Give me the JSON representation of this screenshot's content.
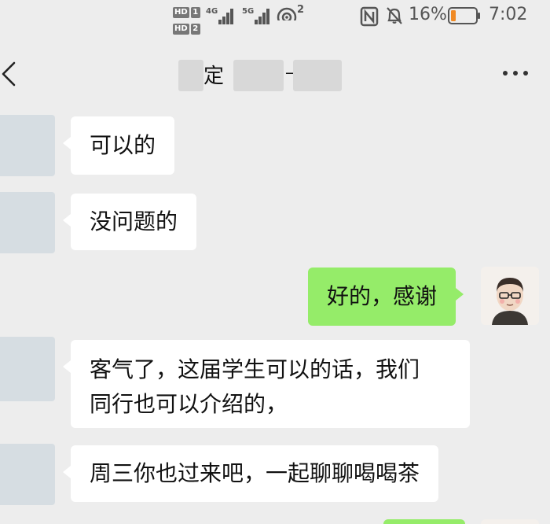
{
  "status_bar": {
    "hd1": "HD",
    "hd1_num": "1",
    "hd2": "HD",
    "hd2_num": "2",
    "net1": "4G",
    "net2": "5G",
    "hotspot_num": "2",
    "battery": "16%",
    "time": "7:02",
    "icons": [
      "nfc-icon",
      "mute-icon",
      "battery-icon",
      "hotspot-icon"
    ]
  },
  "header": {
    "title_visible": "定",
    "title_separator": "—",
    "back_icon": "back-chevron-icon",
    "more_icon": "more-dots-icon"
  },
  "messages": [
    {
      "side": "left",
      "text": "可以的"
    },
    {
      "side": "left",
      "text": "没问题的"
    },
    {
      "side": "right",
      "text": "好的，感谢"
    },
    {
      "side": "left",
      "text_line1": "客气了，这届学生可以的话，我们",
      "text_line2": "同行也可以介绍的，"
    },
    {
      "side": "left",
      "text": "周三你也过来吧，一起聊聊喝喝茶"
    }
  ],
  "colors": {
    "background": "#ededed",
    "incoming_bubble": "#ffffff",
    "outgoing_bubble": "#95ec69",
    "battery_low": "#f08a24"
  }
}
